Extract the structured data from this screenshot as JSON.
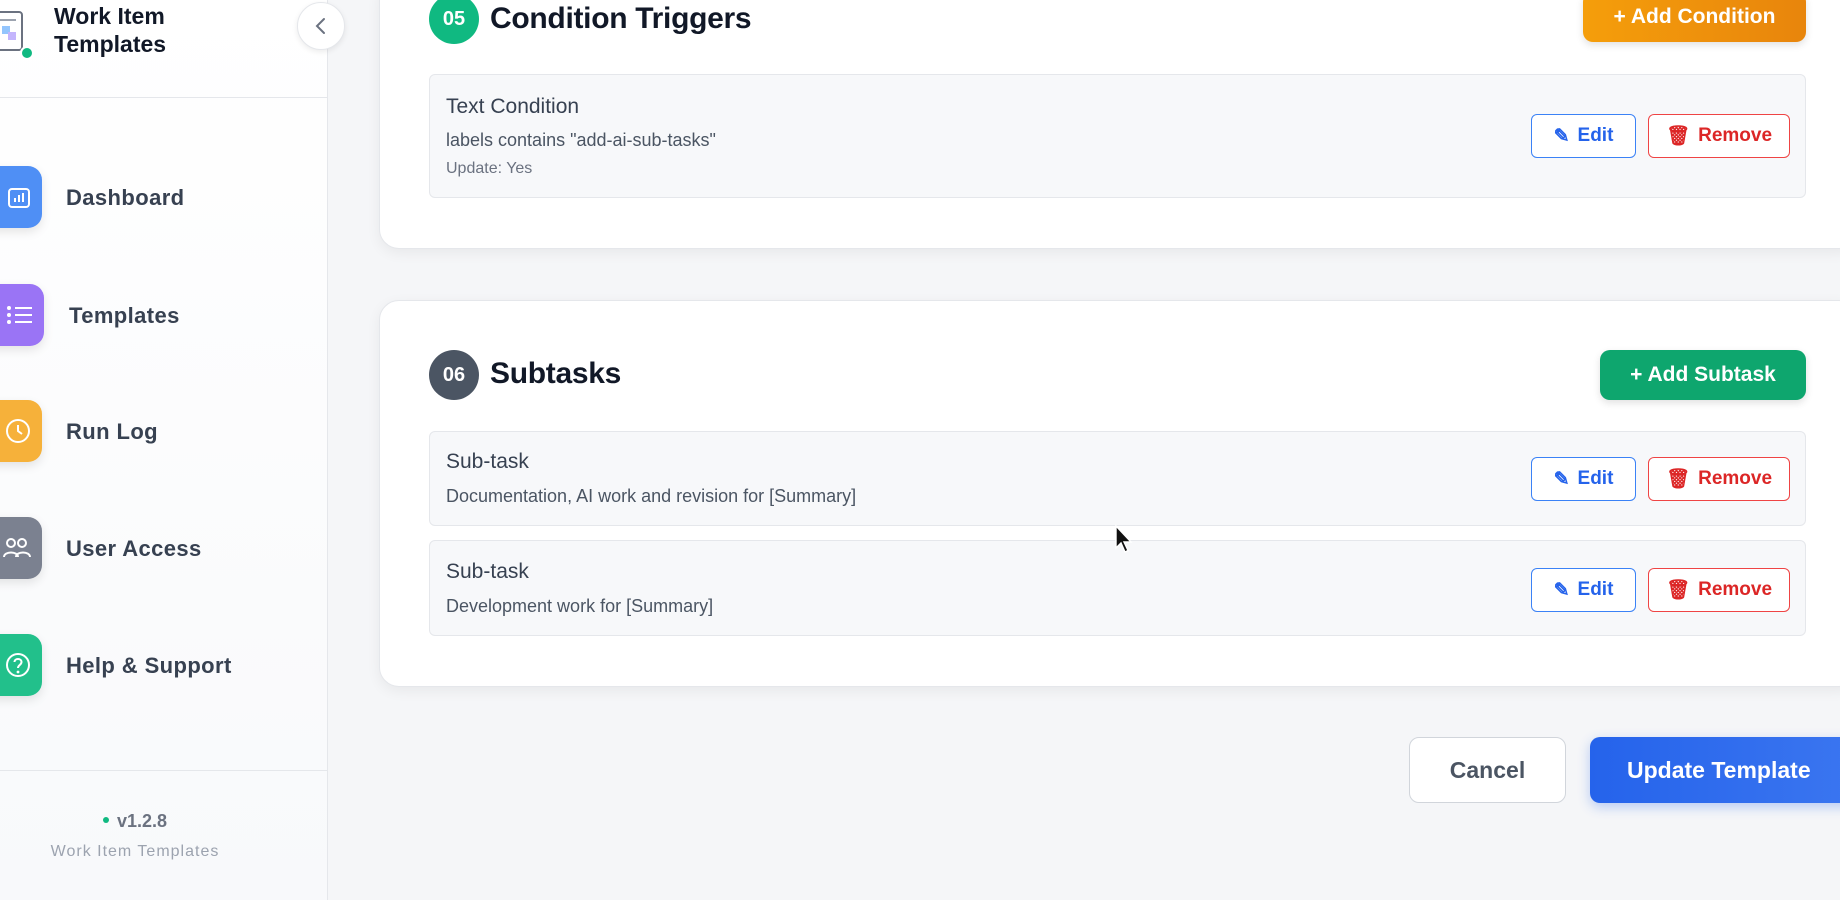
{
  "brand": {
    "title": "Work Item Templates"
  },
  "nav": [
    {
      "label": "Dashboard",
      "icon": "chart-icon",
      "color": "#3b82f6"
    },
    {
      "label": "Templates",
      "icon": "list-icon",
      "color": "#8b5cf6"
    },
    {
      "label": "Run Log",
      "icon": "clock-icon",
      "color": "#f59e0b"
    },
    {
      "label": "User Access",
      "icon": "users-icon",
      "color": "#6b7280"
    },
    {
      "label": "Help & Support",
      "icon": "help-icon",
      "color": "#10b981"
    }
  ],
  "footer": {
    "version": "v1.2.8",
    "name": "Work Item Templates"
  },
  "conditions": {
    "step": "05",
    "title": "Condition Triggers",
    "add_label": "+ Add Condition",
    "items": [
      {
        "title": "Text Condition",
        "desc": "labels contains \"add-ai-sub-tasks\"",
        "meta": "Update: Yes"
      }
    ]
  },
  "subtasks": {
    "step": "06",
    "title": "Subtasks",
    "add_label": "+ Add Subtask",
    "items": [
      {
        "title": "Sub-task",
        "desc": "Documentation, AI work and revision for [Summary]"
      },
      {
        "title": "Sub-task",
        "desc": "Development work for [Summary]"
      }
    ]
  },
  "actions": {
    "edit": "Edit",
    "remove": "Remove",
    "cancel": "Cancel",
    "update": "Update Template"
  },
  "colors": {
    "green": "#10b981",
    "orange": "#f59e0b",
    "gray_badge": "#4b5563",
    "blue": "#2563eb",
    "red": "#dc2626"
  }
}
